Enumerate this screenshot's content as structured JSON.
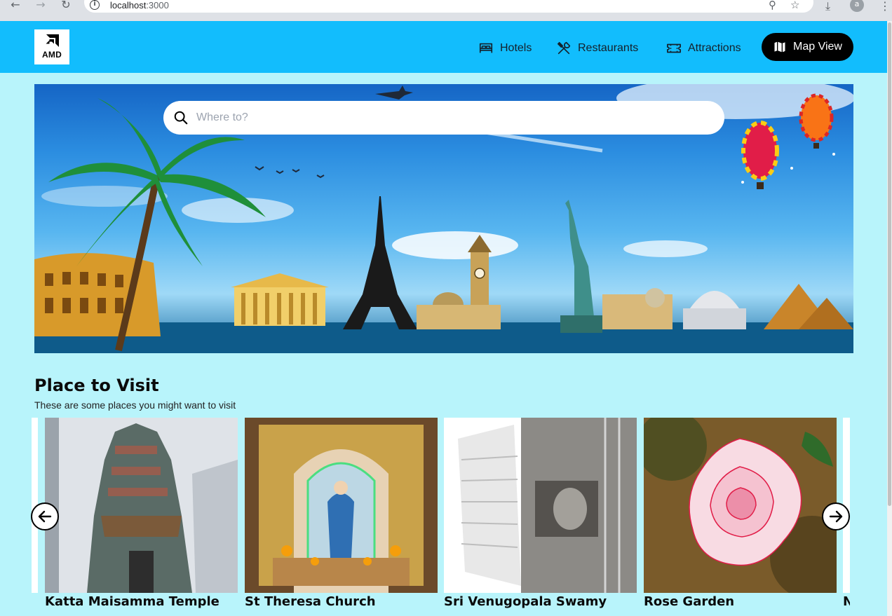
{
  "browser": {
    "url_host": "localhost",
    "url_port": ":3000",
    "profile_initial": "a"
  },
  "header": {
    "logo_text": "AMD",
    "menu": [
      {
        "label": "Hotels",
        "icon": "bed-icon"
      },
      {
        "label": "Restaurants",
        "icon": "utensils-icon"
      },
      {
        "label": "Attractions",
        "icon": "ticket-icon"
      }
    ],
    "map_view_label": "Map View"
  },
  "search": {
    "placeholder": "Where to?",
    "value": ""
  },
  "section": {
    "title": "Place to Visit",
    "subtitle": "These are some places you might want to visit"
  },
  "places": [
    {
      "name": "Katta Maisamma Temple"
    },
    {
      "name": "St Theresa Church"
    },
    {
      "name": "Sri Venugopala Swamy"
    },
    {
      "name": "Rose Garden"
    },
    {
      "name": "N"
    }
  ],
  "colors": {
    "header_bg": "#12bdfd",
    "page_bg": "#b8f4fb",
    "button_dark": "#000000"
  }
}
